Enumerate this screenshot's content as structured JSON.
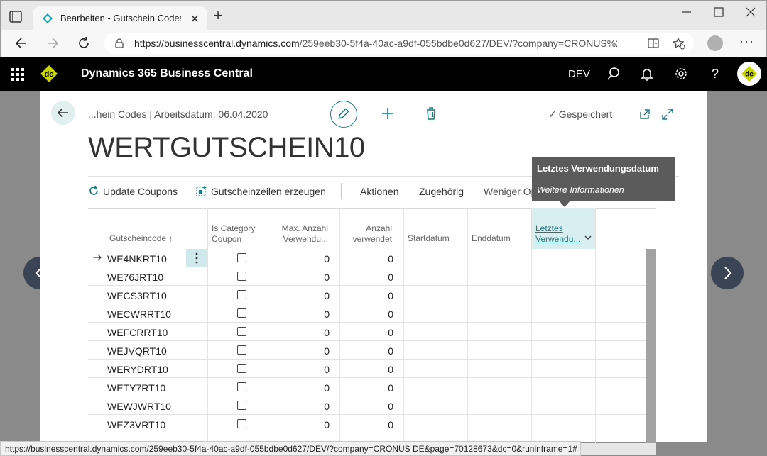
{
  "browser": {
    "tab_title": "Bearbeiten - Gutschein Codes - \\",
    "url_host": "https://businesscentral.dynamics.com",
    "url_path": "/259eeb30-5f4a-40ac-a9df-055bdbe0d627/DEV/?company=CRONUS%20D..."
  },
  "app": {
    "name": "Dynamics 365 Business Central",
    "environment": "DEV",
    "logo_text": "dc"
  },
  "page": {
    "breadcrumb": "...hein Codes | Arbeitsdatum: 06.04.2020",
    "saved_status": "Gespeichert",
    "title": "WERTGUTSCHEIN10"
  },
  "actions": {
    "update_coupons": "Update Coupons",
    "generate_lines": "Gutscheinzeilen erzeugen",
    "aktionen": "Aktionen",
    "zugehoerig": "Zugehörig",
    "weniger": "Weniger Optionen"
  },
  "tooltip": {
    "title": "Letztes Verwendungsdatum",
    "link": "Weitere Informationen"
  },
  "grid": {
    "headers": {
      "code": "Gutscheincode",
      "is_category_1": "Is Category",
      "is_category_2": "Coupon",
      "max_1": "Max. Anzahl",
      "max_2": "Verwendu...",
      "used_1": "Anzahl",
      "used_2": "verwendet",
      "start": "Startdatum",
      "end": "Enddatum",
      "last_1": "Letztes",
      "last_2": "Verwendu..."
    },
    "sort_indicator": "↑",
    "rows": [
      {
        "code": "WE4NKRT10",
        "max": "0",
        "used": "0"
      },
      {
        "code": "WE76JRT10",
        "max": "0",
        "used": "0"
      },
      {
        "code": "WECS3RT10",
        "max": "0",
        "used": "0"
      },
      {
        "code": "WECWRRT10",
        "max": "0",
        "used": "0"
      },
      {
        "code": "WEFCRRT10",
        "max": "0",
        "used": "0"
      },
      {
        "code": "WEJVQRT10",
        "max": "0",
        "used": "0"
      },
      {
        "code": "WERYDRT10",
        "max": "0",
        "used": "0"
      },
      {
        "code": "WETY7RT10",
        "max": "0",
        "used": "0"
      },
      {
        "code": "WEWJWRT10",
        "max": "0",
        "used": "0"
      },
      {
        "code": "WEZ3VRT10",
        "max": "0",
        "used": "0"
      }
    ]
  },
  "statusbar": {
    "url": "https://businesscentral.dynamics.com/259eeb30-5f4a-40ac-a9df-055bdbe0d627/DEV/?company=CRONUS DE&page=70128673&dc=0&runinframe=1#"
  },
  "colors": {
    "accent": "#1b7a80",
    "header_bg": "#000000",
    "logo_bg": "#c8d400",
    "tooltip_bg": "#5b5b5b"
  }
}
